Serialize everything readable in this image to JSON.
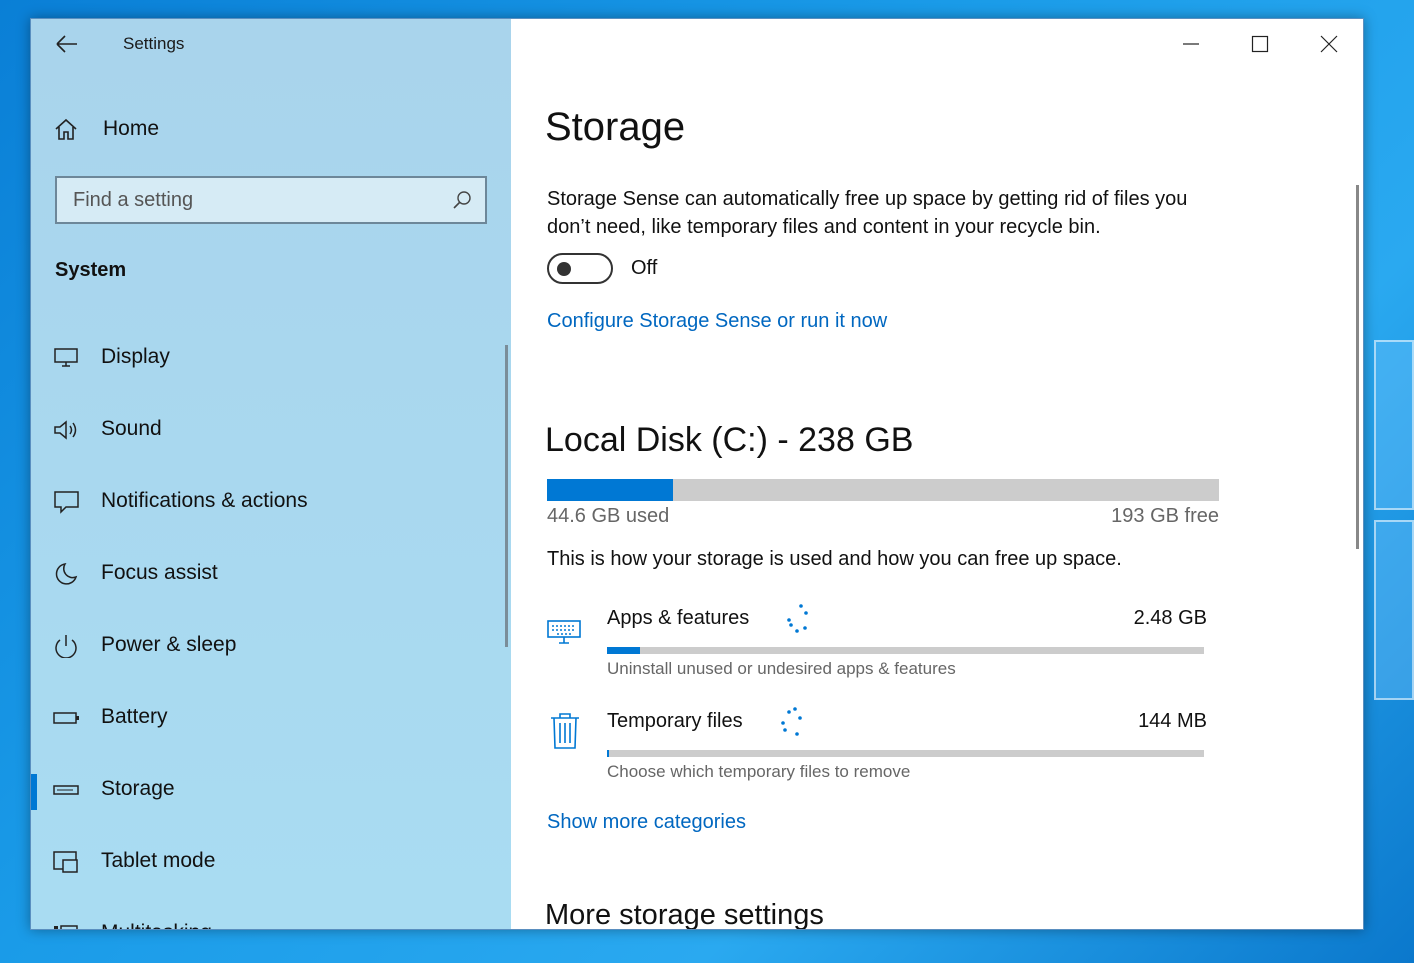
{
  "app": {
    "title": "Settings"
  },
  "sidebar": {
    "home_label": "Home",
    "search_placeholder": "Find a setting",
    "section": "System",
    "items": [
      {
        "label": "Display",
        "icon": "monitor-icon"
      },
      {
        "label": "Sound",
        "icon": "speaker-icon"
      },
      {
        "label": "Notifications & actions",
        "icon": "message-icon"
      },
      {
        "label": "Focus assist",
        "icon": "moon-icon"
      },
      {
        "label": "Power & sleep",
        "icon": "power-icon"
      },
      {
        "label": "Battery",
        "icon": "battery-icon"
      },
      {
        "label": "Storage",
        "icon": "drive-icon",
        "active": true
      },
      {
        "label": "Tablet mode",
        "icon": "tablet-icon"
      },
      {
        "label": "Multitasking",
        "icon": "multitasking-icon"
      }
    ]
  },
  "main": {
    "title": "Storage",
    "description": "Storage Sense can automatically free up space by getting rid of files you don’t need, like temporary files and content in your recycle bin.",
    "toggle_state": "Off",
    "configure_link": "Configure Storage Sense or run it now",
    "disk": {
      "title": "Local Disk (C:) - 238 GB",
      "used_label": "44.6 GB used",
      "free_label": "193 GB free",
      "used_fraction": 0.187
    },
    "usage_desc": "This is how your storage is used and how you can free up space.",
    "categories": [
      {
        "name": "Apps & features",
        "size": "2.48 GB",
        "sub": "Uninstall unused or undesired apps & features",
        "fraction": 0.055,
        "icon": "keyboard-icon"
      },
      {
        "name": "Temporary files",
        "size": "144 MB",
        "sub": "Choose which temporary files to remove",
        "fraction": 0.004,
        "icon": "trash-icon"
      }
    ],
    "show_more_link": "Show more categories",
    "more_title": "More storage settings"
  },
  "colors": {
    "accent": "#0078d4",
    "link": "#0067c0",
    "sidebar_bg": "#a9dcf2"
  }
}
